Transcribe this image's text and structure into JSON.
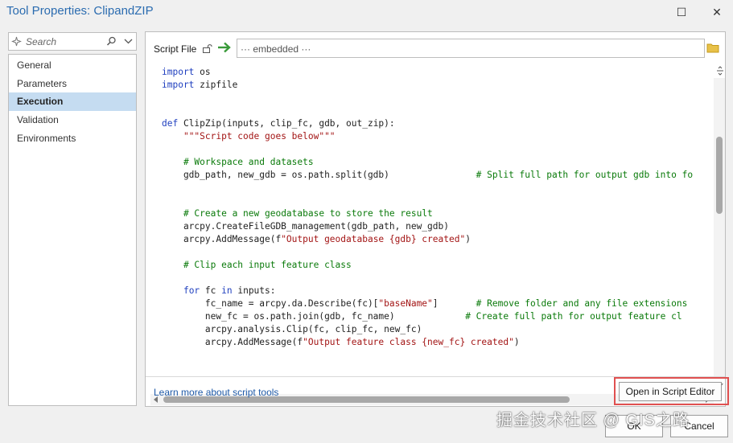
{
  "window": {
    "title": "Tool Properties: ClipandZIP",
    "maximize_glyph": "☐",
    "close_glyph": "✕"
  },
  "sidebar": {
    "search_placeholder": "Search",
    "items": [
      {
        "label": "General",
        "selected": false
      },
      {
        "label": "Parameters",
        "selected": false
      },
      {
        "label": "Execution",
        "selected": true
      },
      {
        "label": "Validation",
        "selected": false
      },
      {
        "label": "Environments",
        "selected": false
      }
    ]
  },
  "script": {
    "label": "Script File",
    "path": "··· embedded ···",
    "code": [
      [
        [
          "kw",
          "import"
        ],
        [
          "t",
          " os"
        ]
      ],
      [
        [
          "kw",
          "import"
        ],
        [
          "t",
          " zipfile"
        ]
      ],
      [],
      [],
      [
        [
          "kw",
          "def"
        ],
        [
          "t",
          " ClipZip(inputs, clip_fc, gdb, out_zip):"
        ]
      ],
      [
        [
          "t",
          "    "
        ],
        [
          "str",
          "\"\"\"Script code goes below\"\"\""
        ]
      ],
      [],
      [
        [
          "t",
          "    "
        ],
        [
          "com",
          "# Workspace and datasets"
        ]
      ],
      [
        [
          "t",
          "    gdb_path, new_gdb = os.path.split(gdb)                "
        ],
        [
          "com",
          "# Split full path for output gdb into fo"
        ]
      ],
      [],
      [],
      [
        [
          "t",
          "    "
        ],
        [
          "com",
          "# Create a new geodatabase to store the result"
        ]
      ],
      [
        [
          "t",
          "    arcpy.CreateFileGDB_management(gdb_path, new_gdb)"
        ]
      ],
      [
        [
          "t",
          "    arcpy.AddMessage(f"
        ],
        [
          "str",
          "\"Output geodatabase {gdb} created\""
        ],
        [
          "t",
          ")"
        ]
      ],
      [],
      [
        [
          "t",
          "    "
        ],
        [
          "com",
          "# Clip each input feature class"
        ]
      ],
      [],
      [
        [
          "t",
          "    "
        ],
        [
          "kw",
          "for"
        ],
        [
          "t",
          " fc "
        ],
        [
          "kw",
          "in"
        ],
        [
          "t",
          " inputs:"
        ]
      ],
      [
        [
          "t",
          "        fc_name = arcpy.da.Describe(fc)["
        ],
        [
          "str",
          "\"baseName\""
        ],
        [
          "t",
          "]       "
        ],
        [
          "com",
          "# Remove folder and any file extensions"
        ]
      ],
      [
        [
          "t",
          "        new_fc = os.path.join(gdb, fc_name)             "
        ],
        [
          "com",
          "# Create full path for output feature cl"
        ]
      ],
      [
        [
          "t",
          "        arcpy.analysis.Clip(fc, clip_fc, new_fc)"
        ]
      ],
      [
        [
          "t",
          "        arcpy.AddMessage(f"
        ],
        [
          "str",
          "\"Output feature class {new_fc} created\""
        ],
        [
          "t",
          ")"
        ]
      ]
    ]
  },
  "footer": {
    "learn_link": "Learn more about script tools",
    "open_editor_label": "Open in Script Editor",
    "ok_label": "OK",
    "cancel_label": "Cancel"
  },
  "watermark": "掘金技术社区 @ GIS之路",
  "colors": {
    "title": "#2b6cb0",
    "selection": "#c5dcf1",
    "keyword": "#1f3fbf",
    "string": "#a31515",
    "comment": "#0a7a0a",
    "highlight_border": "#e05050",
    "link": "#1f5aa8",
    "arrow": "#3a9a3a"
  }
}
